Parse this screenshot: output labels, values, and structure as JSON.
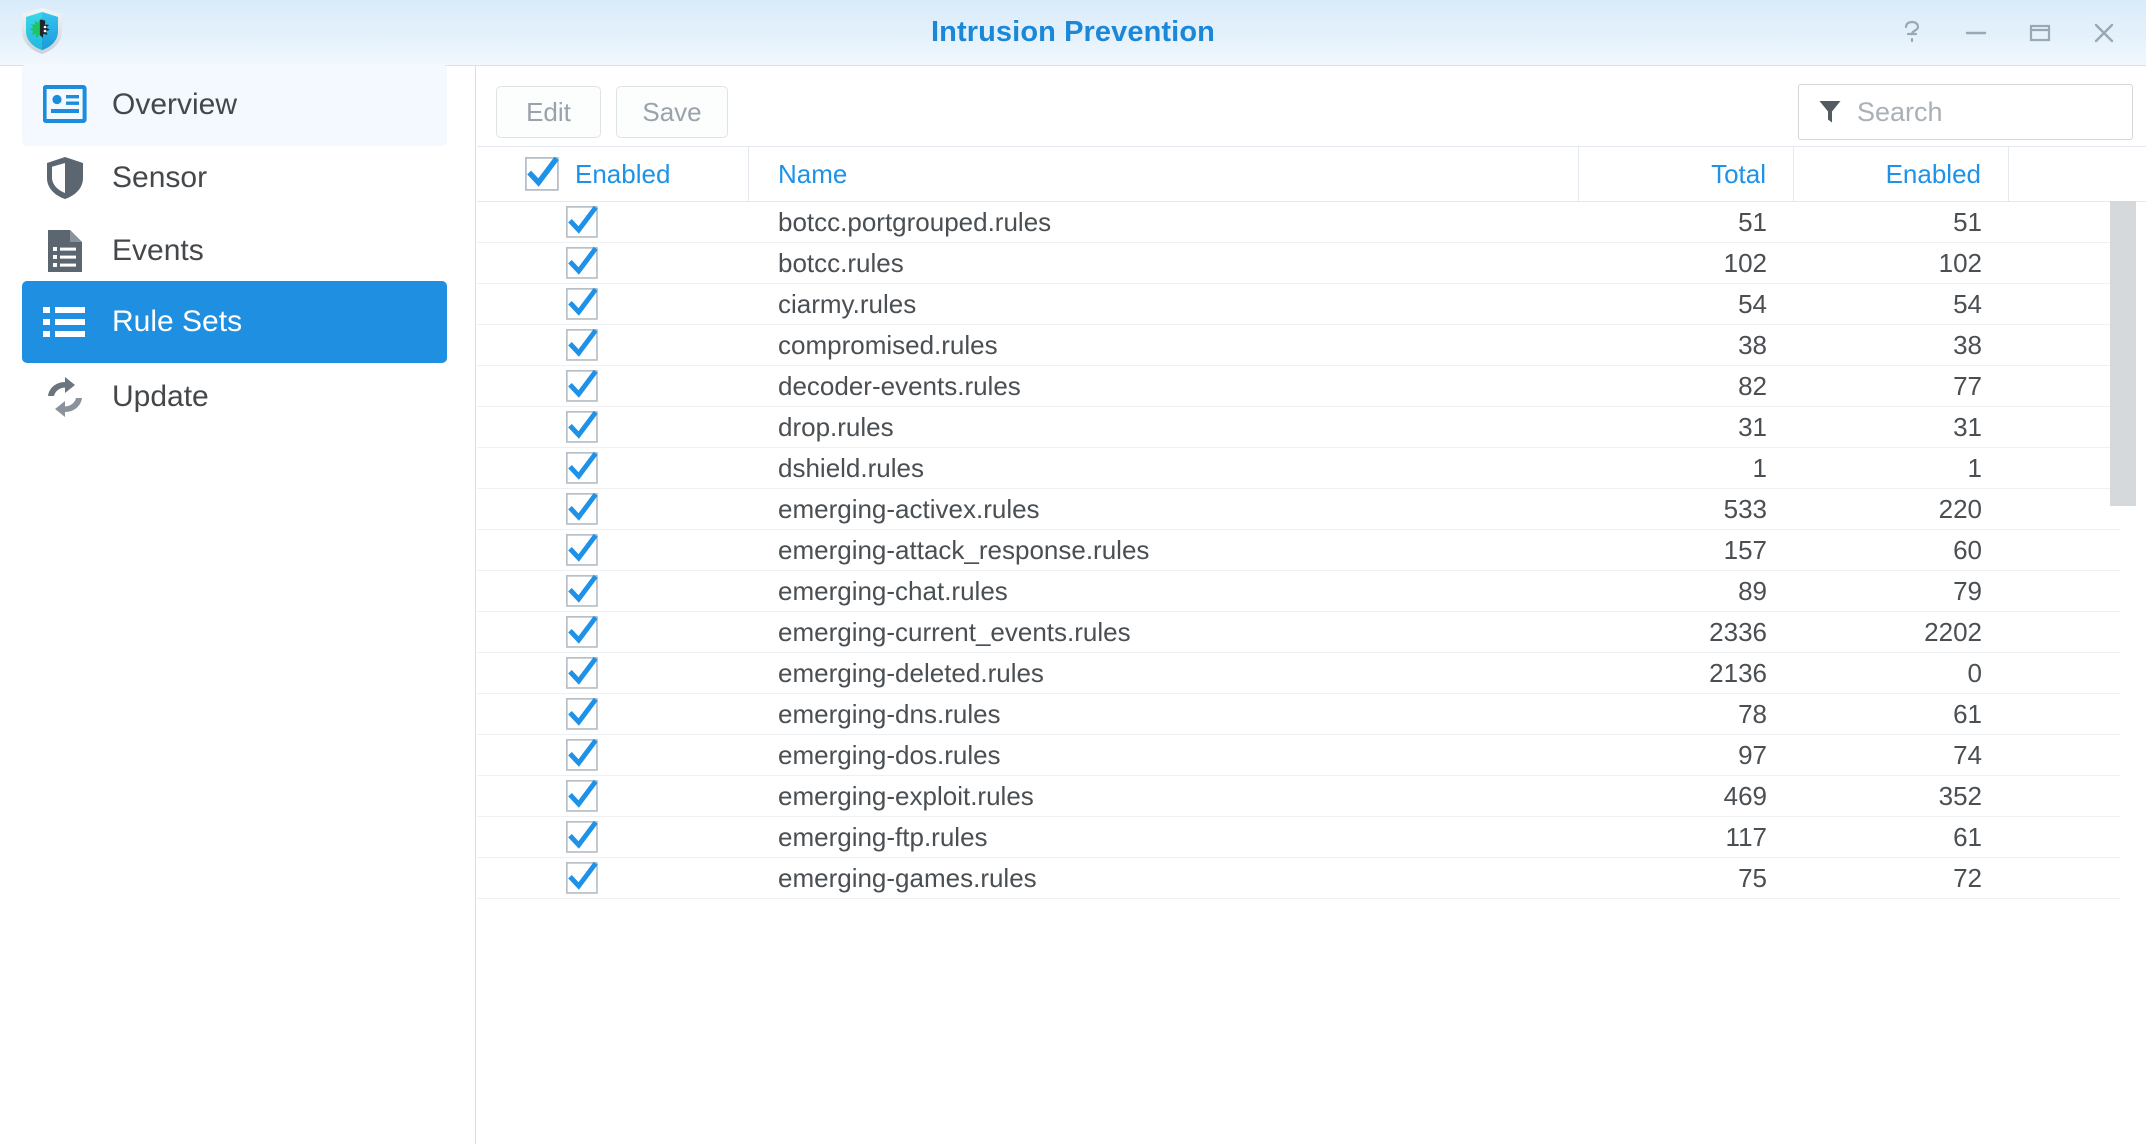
{
  "window": {
    "title": "Intrusion Prevention",
    "logo_icon": "shield-bug-icon",
    "controls": [
      {
        "name": "help-button",
        "icon": "question-mark-icon",
        "label": "?"
      },
      {
        "name": "minimize-button",
        "icon": "minimize-icon",
        "label": "–"
      },
      {
        "name": "maximize-button",
        "icon": "maximize-icon",
        "label": "□"
      },
      {
        "name": "close-button",
        "icon": "close-icon",
        "label": "✕"
      }
    ]
  },
  "sidebar": {
    "items": [
      {
        "label": "Overview",
        "icon": "id-card-icon",
        "state": "hovered"
      },
      {
        "label": "Sensor",
        "icon": "shield-icon",
        "state": "normal"
      },
      {
        "label": "Events",
        "icon": "document-list-icon",
        "state": "normal"
      },
      {
        "label": "Rule Sets",
        "icon": "bullet-list-icon",
        "state": "active"
      },
      {
        "label": "Update",
        "icon": "refresh-icon",
        "state": "normal"
      }
    ]
  },
  "toolbar": {
    "edit_label": "Edit",
    "save_label": "Save",
    "edit_disabled": true,
    "save_disabled": true
  },
  "search": {
    "icon": "filter-funnel-icon",
    "placeholder": "Search",
    "value": ""
  },
  "table": {
    "select_all_checked": true,
    "columns": [
      {
        "key": "enabled_chk",
        "label": "Enabled"
      },
      {
        "key": "name",
        "label": "Name"
      },
      {
        "key": "total",
        "label": "Total"
      },
      {
        "key": "enabled",
        "label": "Enabled"
      }
    ],
    "rows": [
      {
        "checked": true,
        "name": "botcc.portgrouped.rules",
        "total": "51",
        "enabled": "51"
      },
      {
        "checked": true,
        "name": "botcc.rules",
        "total": "102",
        "enabled": "102"
      },
      {
        "checked": true,
        "name": "ciarmy.rules",
        "total": "54",
        "enabled": "54"
      },
      {
        "checked": true,
        "name": "compromised.rules",
        "total": "38",
        "enabled": "38"
      },
      {
        "checked": true,
        "name": "decoder-events.rules",
        "total": "82",
        "enabled": "77"
      },
      {
        "checked": true,
        "name": "drop.rules",
        "total": "31",
        "enabled": "31"
      },
      {
        "checked": true,
        "name": "dshield.rules",
        "total": "1",
        "enabled": "1"
      },
      {
        "checked": true,
        "name": "emerging-activex.rules",
        "total": "533",
        "enabled": "220"
      },
      {
        "checked": true,
        "name": "emerging-attack_response.rules",
        "total": "157",
        "enabled": "60"
      },
      {
        "checked": true,
        "name": "emerging-chat.rules",
        "total": "89",
        "enabled": "79"
      },
      {
        "checked": true,
        "name": "emerging-current_events.rules",
        "total": "2336",
        "enabled": "2202"
      },
      {
        "checked": true,
        "name": "emerging-deleted.rules",
        "total": "2136",
        "enabled": "0"
      },
      {
        "checked": true,
        "name": "emerging-dns.rules",
        "total": "78",
        "enabled": "61"
      },
      {
        "checked": true,
        "name": "emerging-dos.rules",
        "total": "97",
        "enabled": "74"
      },
      {
        "checked": true,
        "name": "emerging-exploit.rules",
        "total": "469",
        "enabled": "352"
      },
      {
        "checked": true,
        "name": "emerging-ftp.rules",
        "total": "117",
        "enabled": "61"
      },
      {
        "checked": true,
        "name": "emerging-games.rules",
        "total": "75",
        "enabled": "72"
      }
    ]
  },
  "scrollbar": {
    "name": "vertical-scrollbar",
    "orientation": "vertical"
  },
  "colors": {
    "accent": "#1e8fe1",
    "title": "#1a87d8",
    "header_link": "#1e92e8",
    "text": "#4a4f53",
    "disabled_text": "#9aa3ab"
  }
}
